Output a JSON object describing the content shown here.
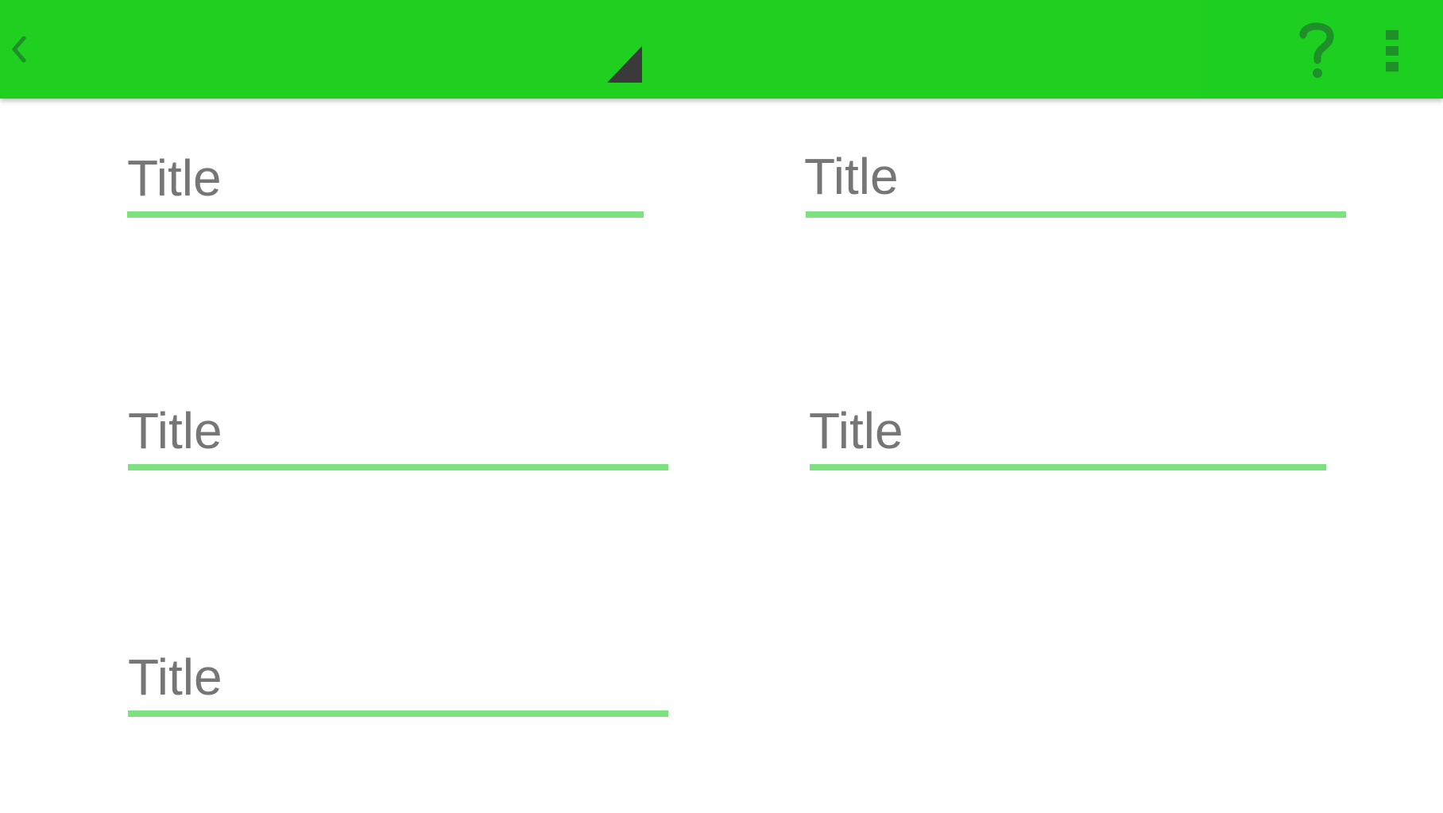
{
  "colors": {
    "toolbar_primary": "#1fd020",
    "toolbar_secondary": "#1ccf21",
    "icon_dark_green": "#1f8f2a",
    "icon_dark": "#3a3a3a",
    "field_text": "#767676",
    "field_underline": "#7ce27f",
    "background": "#ffffff"
  },
  "toolbar": {
    "back_icon": "chevron-left-icon",
    "dropdown_icon": "dropdown-triangle-icon",
    "help_icon": "question-mark-icon",
    "overflow_icon": "more-vertical-icon"
  },
  "fields": [
    {
      "label": "Title"
    },
    {
      "label": "Title"
    },
    {
      "label": "Title"
    },
    {
      "label": "Title"
    },
    {
      "label": "Title"
    }
  ]
}
